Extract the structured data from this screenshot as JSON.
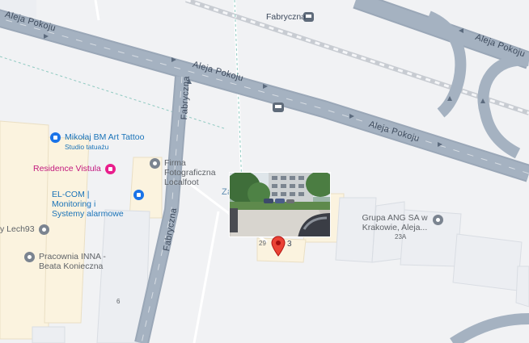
{
  "map": {
    "streets": {
      "aleja_pokoju_1": "Aleja Pokoju",
      "aleja_pokoju_2": "Aleja Pokoju",
      "aleja_pokoju_3": "Aleja Pokoju",
      "aleja_pokoju_4": "Aleja Pokoju",
      "fabryczna_1": "Fabryczna",
      "fabryczna_2": "Fabryczna",
      "za": "Za"
    },
    "stops": {
      "fabryczna": "Fabryczna"
    },
    "pois": [
      {
        "name": "Mikołaj BM Art Tattoo",
        "subtitle": "Studio tatuażu",
        "icon": "shopping-bag-icon",
        "color": "#1a73e8"
      },
      {
        "name": "Residence Vistula",
        "icon": "hotel-bed-icon",
        "color": "#e91e8c"
      },
      {
        "name": "Firma Fotograficzna Localfoot",
        "icon": "place-icon",
        "color": "#7b8490"
      },
      {
        "name": "EL-COM | Monitoring i Systemy alarmowe",
        "icon": "shopping-bag-icon",
        "color": "#1a73e8"
      },
      {
        "name": "y Lech93",
        "icon": "place-icon",
        "color": "#7b8490"
      },
      {
        "name": "Pracownia INNA - Beata Konieczna",
        "icon": "place-icon",
        "color": "#7b8490"
      },
      {
        "name": "Grupa ANG SA w Krakowie, Aleja...",
        "icon": "place-icon",
        "color": "#7b8490"
      }
    ],
    "addresses": {
      "n29": "29",
      "n3": "3",
      "n23a": "23A",
      "n6": "6"
    },
    "marker_color": "#ea4335"
  }
}
